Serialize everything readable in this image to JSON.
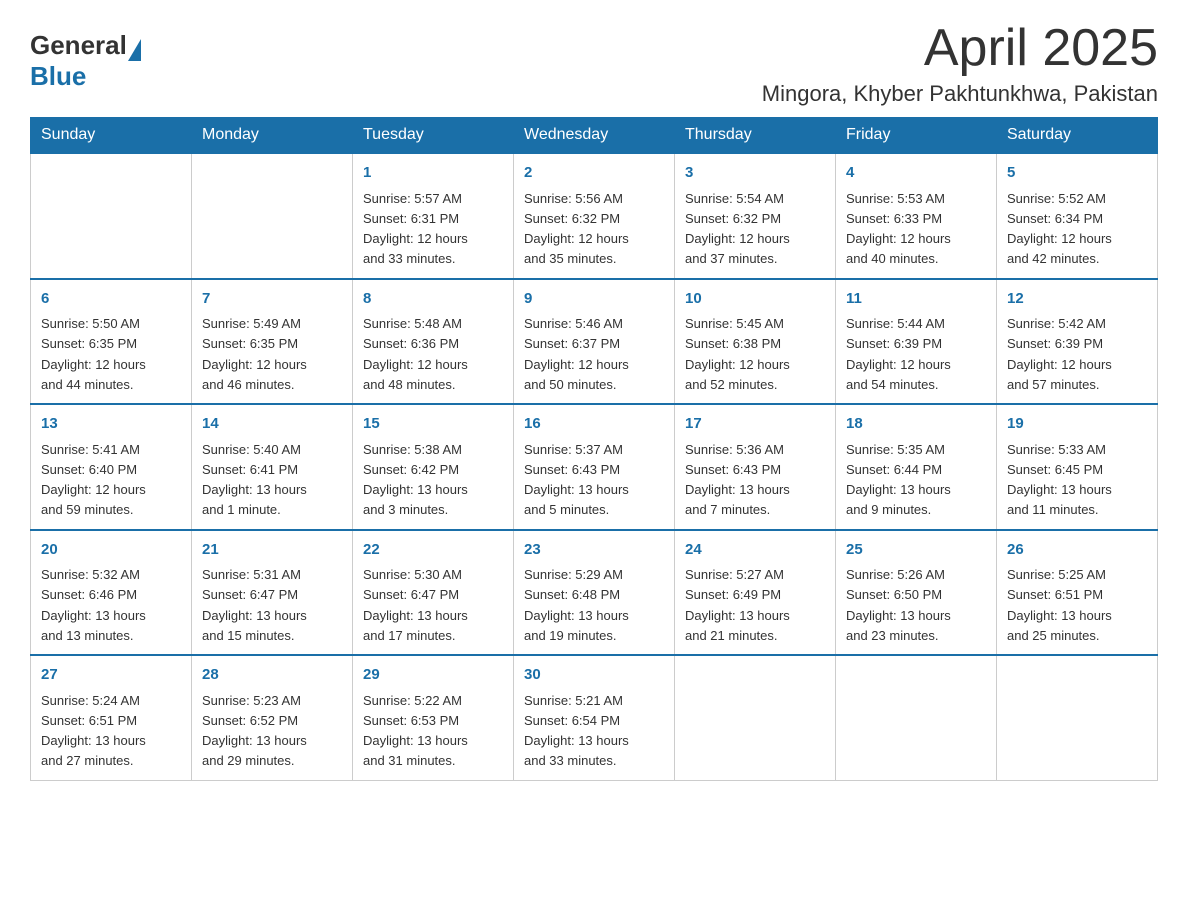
{
  "header": {
    "logo_general": "General",
    "logo_blue": "Blue",
    "month_year": "April 2025",
    "location": "Mingora, Khyber Pakhtunkhwa, Pakistan"
  },
  "weekdays": [
    "Sunday",
    "Monday",
    "Tuesday",
    "Wednesday",
    "Thursday",
    "Friday",
    "Saturday"
  ],
  "weeks": [
    [
      {
        "day": "",
        "info": ""
      },
      {
        "day": "",
        "info": ""
      },
      {
        "day": "1",
        "info": "Sunrise: 5:57 AM\nSunset: 6:31 PM\nDaylight: 12 hours\nand 33 minutes."
      },
      {
        "day": "2",
        "info": "Sunrise: 5:56 AM\nSunset: 6:32 PM\nDaylight: 12 hours\nand 35 minutes."
      },
      {
        "day": "3",
        "info": "Sunrise: 5:54 AM\nSunset: 6:32 PM\nDaylight: 12 hours\nand 37 minutes."
      },
      {
        "day": "4",
        "info": "Sunrise: 5:53 AM\nSunset: 6:33 PM\nDaylight: 12 hours\nand 40 minutes."
      },
      {
        "day": "5",
        "info": "Sunrise: 5:52 AM\nSunset: 6:34 PM\nDaylight: 12 hours\nand 42 minutes."
      }
    ],
    [
      {
        "day": "6",
        "info": "Sunrise: 5:50 AM\nSunset: 6:35 PM\nDaylight: 12 hours\nand 44 minutes."
      },
      {
        "day": "7",
        "info": "Sunrise: 5:49 AM\nSunset: 6:35 PM\nDaylight: 12 hours\nand 46 minutes."
      },
      {
        "day": "8",
        "info": "Sunrise: 5:48 AM\nSunset: 6:36 PM\nDaylight: 12 hours\nand 48 minutes."
      },
      {
        "day": "9",
        "info": "Sunrise: 5:46 AM\nSunset: 6:37 PM\nDaylight: 12 hours\nand 50 minutes."
      },
      {
        "day": "10",
        "info": "Sunrise: 5:45 AM\nSunset: 6:38 PM\nDaylight: 12 hours\nand 52 minutes."
      },
      {
        "day": "11",
        "info": "Sunrise: 5:44 AM\nSunset: 6:39 PM\nDaylight: 12 hours\nand 54 minutes."
      },
      {
        "day": "12",
        "info": "Sunrise: 5:42 AM\nSunset: 6:39 PM\nDaylight: 12 hours\nand 57 minutes."
      }
    ],
    [
      {
        "day": "13",
        "info": "Sunrise: 5:41 AM\nSunset: 6:40 PM\nDaylight: 12 hours\nand 59 minutes."
      },
      {
        "day": "14",
        "info": "Sunrise: 5:40 AM\nSunset: 6:41 PM\nDaylight: 13 hours\nand 1 minute."
      },
      {
        "day": "15",
        "info": "Sunrise: 5:38 AM\nSunset: 6:42 PM\nDaylight: 13 hours\nand 3 minutes."
      },
      {
        "day": "16",
        "info": "Sunrise: 5:37 AM\nSunset: 6:43 PM\nDaylight: 13 hours\nand 5 minutes."
      },
      {
        "day": "17",
        "info": "Sunrise: 5:36 AM\nSunset: 6:43 PM\nDaylight: 13 hours\nand 7 minutes."
      },
      {
        "day": "18",
        "info": "Sunrise: 5:35 AM\nSunset: 6:44 PM\nDaylight: 13 hours\nand 9 minutes."
      },
      {
        "day": "19",
        "info": "Sunrise: 5:33 AM\nSunset: 6:45 PM\nDaylight: 13 hours\nand 11 minutes."
      }
    ],
    [
      {
        "day": "20",
        "info": "Sunrise: 5:32 AM\nSunset: 6:46 PM\nDaylight: 13 hours\nand 13 minutes."
      },
      {
        "day": "21",
        "info": "Sunrise: 5:31 AM\nSunset: 6:47 PM\nDaylight: 13 hours\nand 15 minutes."
      },
      {
        "day": "22",
        "info": "Sunrise: 5:30 AM\nSunset: 6:47 PM\nDaylight: 13 hours\nand 17 minutes."
      },
      {
        "day": "23",
        "info": "Sunrise: 5:29 AM\nSunset: 6:48 PM\nDaylight: 13 hours\nand 19 minutes."
      },
      {
        "day": "24",
        "info": "Sunrise: 5:27 AM\nSunset: 6:49 PM\nDaylight: 13 hours\nand 21 minutes."
      },
      {
        "day": "25",
        "info": "Sunrise: 5:26 AM\nSunset: 6:50 PM\nDaylight: 13 hours\nand 23 minutes."
      },
      {
        "day": "26",
        "info": "Sunrise: 5:25 AM\nSunset: 6:51 PM\nDaylight: 13 hours\nand 25 minutes."
      }
    ],
    [
      {
        "day": "27",
        "info": "Sunrise: 5:24 AM\nSunset: 6:51 PM\nDaylight: 13 hours\nand 27 minutes."
      },
      {
        "day": "28",
        "info": "Sunrise: 5:23 AM\nSunset: 6:52 PM\nDaylight: 13 hours\nand 29 minutes."
      },
      {
        "day": "29",
        "info": "Sunrise: 5:22 AM\nSunset: 6:53 PM\nDaylight: 13 hours\nand 31 minutes."
      },
      {
        "day": "30",
        "info": "Sunrise: 5:21 AM\nSunset: 6:54 PM\nDaylight: 13 hours\nand 33 minutes."
      },
      {
        "day": "",
        "info": ""
      },
      {
        "day": "",
        "info": ""
      },
      {
        "day": "",
        "info": ""
      }
    ]
  ]
}
